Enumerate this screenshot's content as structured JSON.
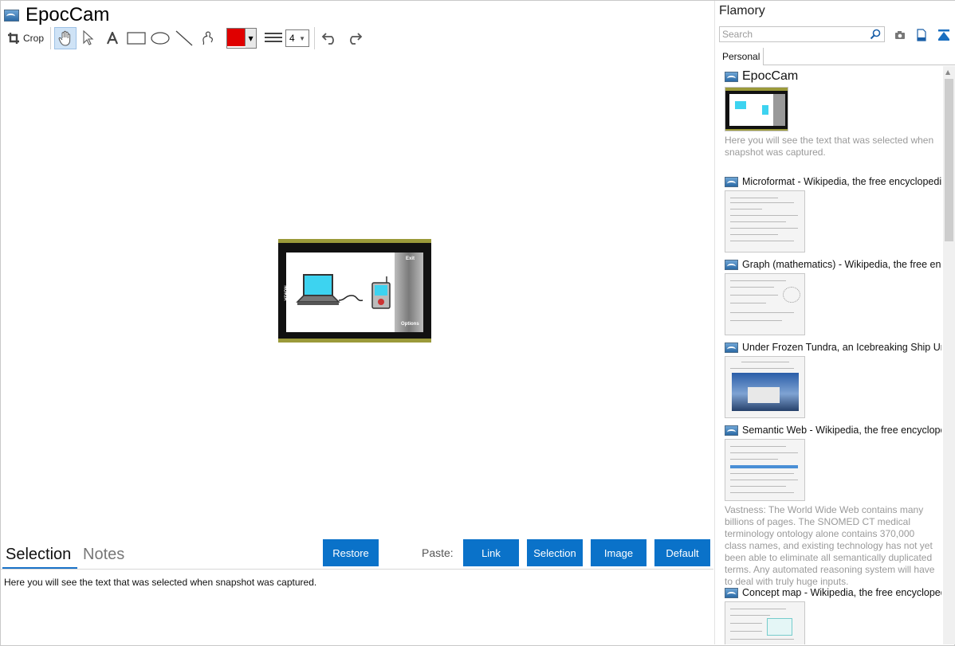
{
  "window": {
    "title": "EpocCam"
  },
  "toolbar": {
    "crop_label": "Crop",
    "color_value": "#e00000",
    "line_width": "4"
  },
  "snapshot": {
    "exit_label": "Exit",
    "options_label": "Options",
    "brand_label": "NOKIA"
  },
  "bottom": {
    "tab_selection": "Selection",
    "tab_notes": "Notes",
    "restore_label": "Restore",
    "paste_label": "Paste:",
    "paste_buttons": [
      "Link",
      "Selection",
      "Image",
      "Default"
    ],
    "selection_text": "Here you will see the text that was selected when snapshot was captured."
  },
  "sidebar": {
    "title": "Flamory",
    "search_placeholder": "Search",
    "tab_personal": "Personal",
    "items": [
      {
        "title": "EpocCam",
        "desc": "Here you will see the text that was selected when snapshot was captured."
      },
      {
        "title": "Microformat - Wikipedia, the free encyclopedia"
      },
      {
        "title": "Graph (mathematics) - Wikipedia, the free ency"
      },
      {
        "title": "Under Frozen Tundra, an Icebreaking Ship Unco"
      },
      {
        "title": "Semantic Web - Wikipedia, the free encycloped",
        "desc": "Vastness: The World Wide Web contains many billions of pages. The SNOMED CT medical terminology ontology alone contains 370,000 class names, and existing technology has not yet been able to eliminate all semantically duplicated terms. Any automated reasoning system will have to deal with truly huge inputs."
      },
      {
        "title": "Concept map - Wikipedia, the free encyclopedia"
      }
    ]
  },
  "colors": {
    "accent": "#0a72c9",
    "selection_highlight": "#cfe3f6"
  }
}
